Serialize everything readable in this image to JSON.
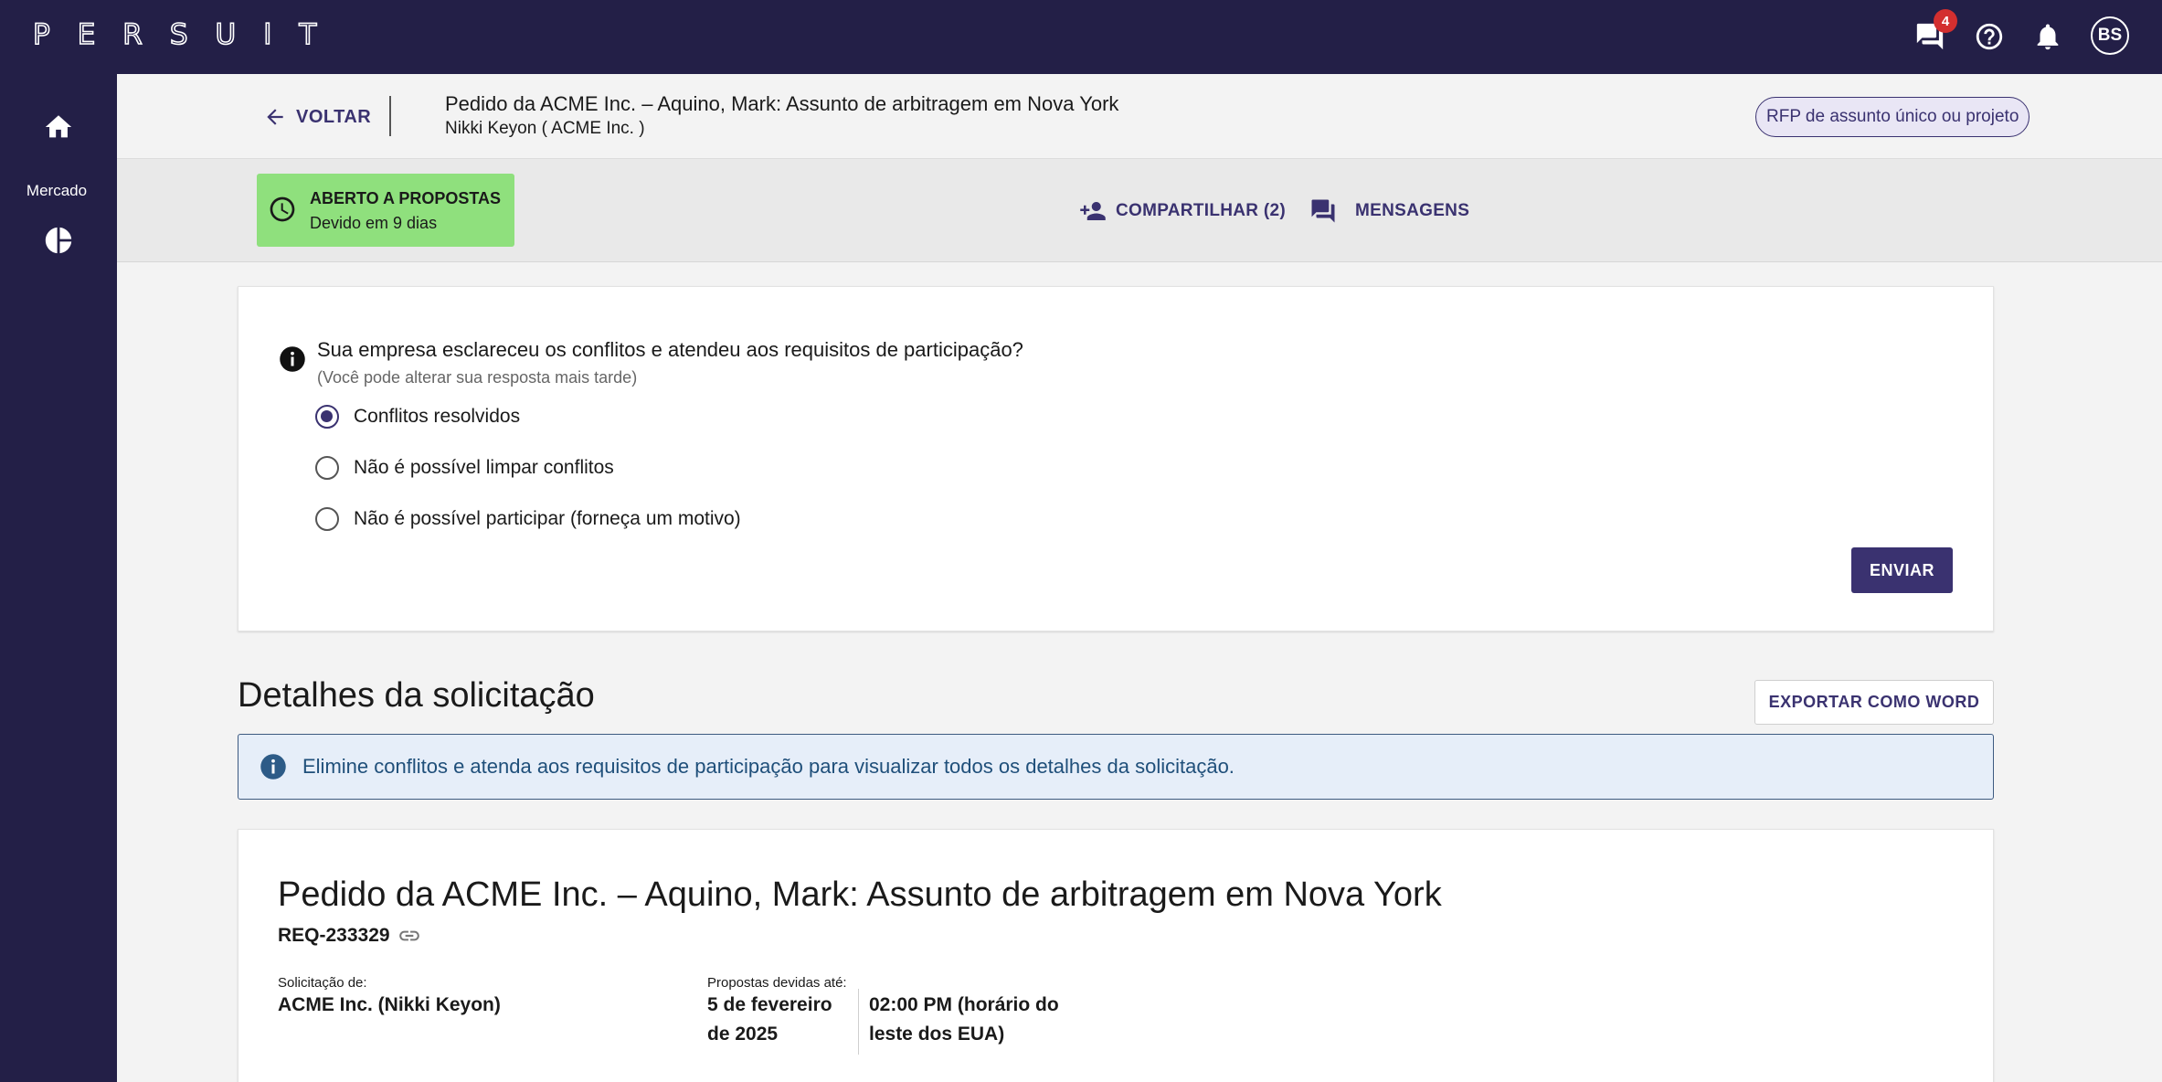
{
  "app": {
    "logo_text": "PERSUIT",
    "messages_badge": "4",
    "user_initials": "BS"
  },
  "sidebar": {
    "items": [
      {
        "icon": "home-icon",
        "label": ""
      },
      {
        "icon": "pie-chart-icon",
        "label": "Mercado"
      }
    ]
  },
  "header": {
    "back_label": "VOLTAR",
    "title": "Pedido da ACME Inc. – Aquino, Mark: Assunto de arbitragem em Nova York",
    "subtitle": "Nikki Keyon ( ACME Inc. )",
    "rfp_type": "RFP de assunto único ou projeto"
  },
  "status": {
    "title": "ABERTO A PROPOSTAS",
    "due": "Devido em 9 dias",
    "color": "#8fe07d"
  },
  "actions": {
    "share_label": "COMPARTILHAR (2)",
    "messages_label": "MENSAGENS"
  },
  "conflict_question": {
    "question": "Sua empresa esclareceu os conflitos e atendeu aos requisitos de participação?",
    "hint": "(Você pode alterar sua resposta mais tarde)",
    "options": [
      {
        "label": "Conflitos resolvidos",
        "selected": true
      },
      {
        "label": "Não é possível limpar conflitos",
        "selected": false
      },
      {
        "label": "Não é possível participar (forneça um motivo)",
        "selected": false
      }
    ],
    "submit_label": "ENVIAR"
  },
  "details": {
    "section_title": "Detalhes da solicitação",
    "export_label": "EXPORTAR COMO WORD",
    "alert_text": "Elimine conflitos e atenda aos requisitos de participação para visualizar todos os detalhes da solicitação.",
    "request_title": "Pedido da ACME Inc. – Aquino, Mark: Assunto de arbitragem em Nova York",
    "request_id": "REQ-233329",
    "requested_by_label": "Solicitação de:",
    "requested_by": "ACME Inc. (Nikki Keyon)",
    "due_label": "Propostas devidas até:",
    "due_date_line1": "5 de fevereiro",
    "due_date_line2": "de 2025",
    "due_time_line1": "02:00 PM (horário do",
    "due_time_line2": "leste dos EUA)"
  },
  "colors": {
    "brand": "#231f47",
    "accent": "#3a3270",
    "status_open": "#8fe07d",
    "alert_bg": "#e6eef9",
    "alert_text": "#1f4f7a",
    "badge": "#d32f2f"
  }
}
